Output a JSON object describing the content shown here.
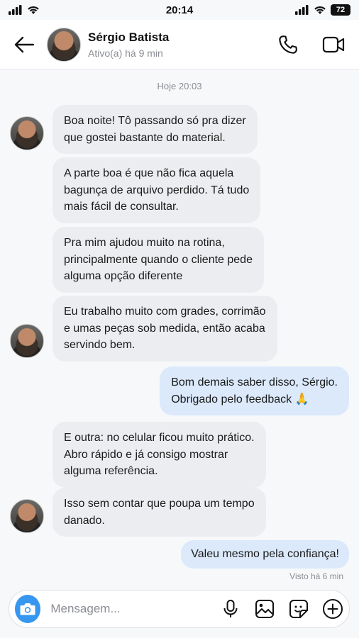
{
  "status_bar": {
    "time": "20:14",
    "battery": "72"
  },
  "header": {
    "contact_name": "Sérgio Batista",
    "status": "Ativo(a) há 9 min"
  },
  "chat": {
    "date_separator": "Hoje 20:03",
    "messages": [
      {
        "direction": "in",
        "lines": [
          "Boa noite! Tô passando só pra dizer",
          "que gostei bastante do material."
        ]
      },
      {
        "direction": "in",
        "lines": [
          "A parte boa é que não fica aquela",
          "bagunça de arquivo perdido. Tá tudo",
          "mais fácil de consultar."
        ]
      },
      {
        "direction": "in",
        "lines": [
          "Pra mim ajudou muito na rotina,",
          "principalmente quando o cliente pede",
          "alguma opção diferente"
        ]
      },
      {
        "direction": "in",
        "lines": [
          "Eu trabalho muito com grades, corrimão",
          "e umas peças sob medida, então acaba",
          "servindo bem."
        ]
      },
      {
        "direction": "out",
        "lines": [
          "Bom demais saber disso, Sérgio.",
          "Obrigado pelo feedback 🙏"
        ]
      },
      {
        "direction": "in",
        "lines": [
          "E outra: no celular ficou muito prático.",
          "Abro rápido e já consigo mostrar",
          "alguma referência."
        ]
      },
      {
        "direction": "in",
        "lines": [
          "Isso sem contar que poupa um tempo",
          "danado."
        ]
      },
      {
        "direction": "out",
        "lines": [
          "Valeu mesmo pela confiança!"
        ]
      }
    ],
    "seen_label": "Visto há 6 min"
  },
  "composer": {
    "placeholder": "Mensagem..."
  },
  "colors": {
    "accent": "#3797f0",
    "incoming_bubble": "#ebedf0",
    "outgoing_bubble": "#dbe9fb"
  }
}
